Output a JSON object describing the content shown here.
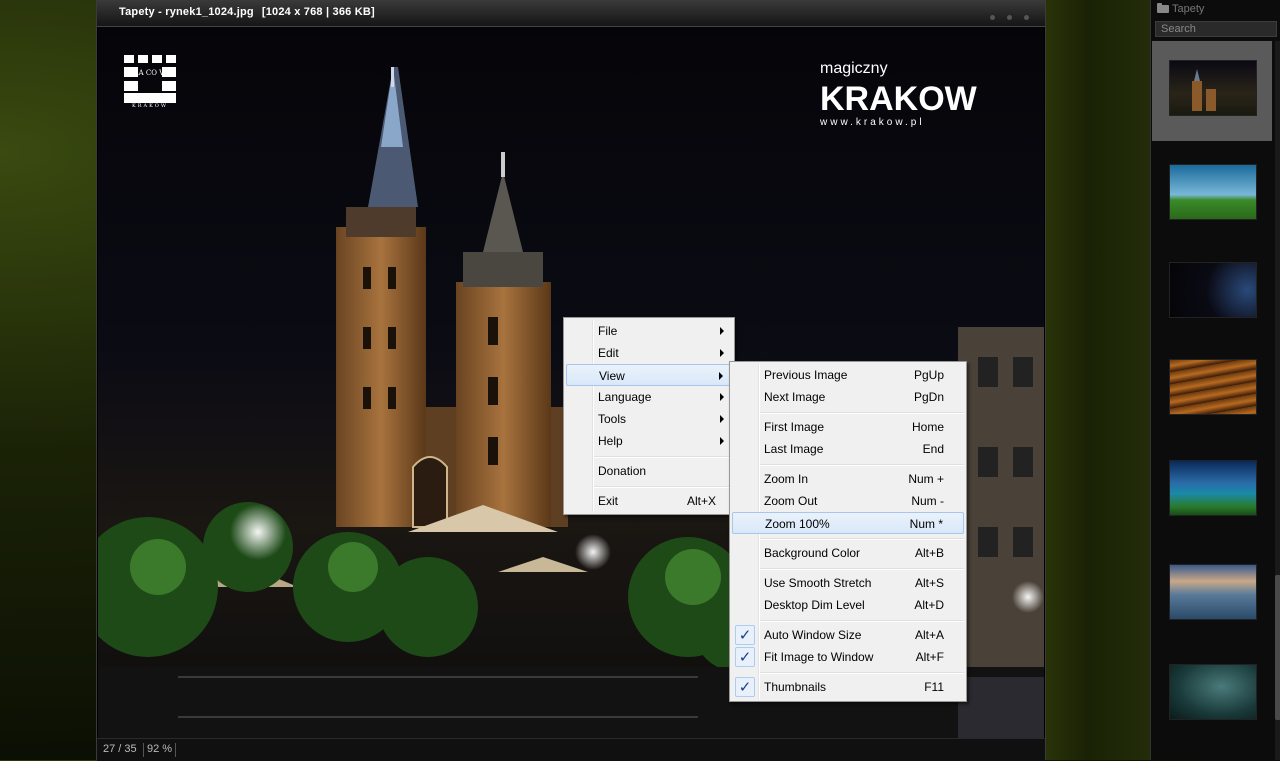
{
  "window": {
    "title": "Tapety - rynek1_1024.jpg",
    "info": "[1024 x 768  |  366 KB]"
  },
  "photo": {
    "logo_left": "CRA CO VIA",
    "logo_left_sub": "KRAKOW",
    "logo_right_small": "magiczny",
    "logo_right_big": "KRAKOW",
    "logo_right_url": "www.krakow.pl"
  },
  "status": {
    "position": "27 / 35",
    "zoom": "92 %"
  },
  "panel": {
    "folder": "Tapety",
    "search_placeholder": "Search",
    "selected_index": 0
  },
  "context_menu": {
    "items": [
      {
        "label": "File",
        "submenu": true
      },
      {
        "label": "Edit",
        "submenu": true
      },
      {
        "label": "View",
        "submenu": true,
        "highlighted": true
      },
      {
        "label": "Language",
        "submenu": true
      },
      {
        "label": "Tools",
        "submenu": true
      },
      {
        "label": "Help",
        "submenu": true
      },
      {
        "label": "Donation"
      },
      {
        "label": "Exit",
        "shortcut": "Alt+X"
      }
    ]
  },
  "view_submenu": {
    "items": [
      {
        "label": "Previous Image",
        "shortcut": "PgUp"
      },
      {
        "label": "Next Image",
        "shortcut": "PgDn"
      },
      {
        "label": "First Image",
        "shortcut": "Home"
      },
      {
        "label": "Last Image",
        "shortcut": "End"
      },
      {
        "label": "Zoom In",
        "shortcut": "Num +"
      },
      {
        "label": "Zoom Out",
        "shortcut": "Num -"
      },
      {
        "label": "Zoom 100%",
        "shortcut": "Num *",
        "highlighted": true
      },
      {
        "label": "Background Color",
        "shortcut": "Alt+B"
      },
      {
        "label": "Use Smooth Stretch",
        "shortcut": "Alt+S"
      },
      {
        "label": "Desktop Dim Level",
        "shortcut": "Alt+D"
      },
      {
        "label": "Auto Window Size",
        "shortcut": "Alt+A",
        "checked": true
      },
      {
        "label": "Fit Image to Window",
        "shortcut": "Alt+F",
        "checked": true
      },
      {
        "label": "Thumbnails",
        "shortcut": "F11",
        "checked": true
      }
    ]
  },
  "colors": {
    "menu_bg": "#f0f0f0",
    "highlight_border": "#a8c6ec",
    "check": "#1b3d8a"
  }
}
